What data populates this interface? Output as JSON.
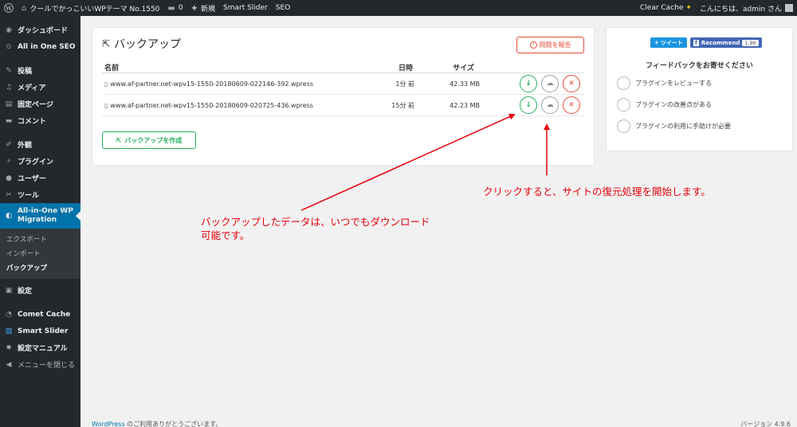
{
  "adminbar": {
    "site_name": "クールでかっこいいWPテーマ No.1550",
    "comments_count": "0",
    "new_label": "新規",
    "smart_slider": "Smart Slider",
    "seo": "SEO",
    "clear_cache": "Clear Cache",
    "greeting": "こんにちは、admin さん"
  },
  "sidebar": {
    "items": [
      {
        "label": "ダッシュボード",
        "icon": "dashboard-icon",
        "glyph": "◉"
      },
      {
        "label": "All in One SEO",
        "icon": "seo-icon",
        "glyph": "⊙"
      },
      {
        "label": "投稿",
        "icon": "pin-icon",
        "glyph": "✎"
      },
      {
        "label": "メディア",
        "icon": "media-icon",
        "glyph": "♫"
      },
      {
        "label": "固定ページ",
        "icon": "page-icon",
        "glyph": "▤"
      },
      {
        "label": "コメント",
        "icon": "comment-icon",
        "glyph": "▬"
      },
      {
        "label": "外観",
        "icon": "appearance-icon",
        "glyph": "✐"
      },
      {
        "label": "プラグイン",
        "icon": "plugin-icon",
        "glyph": "⚡"
      },
      {
        "label": "ユーザー",
        "icon": "user-icon",
        "glyph": "●"
      },
      {
        "label": "ツール",
        "icon": "tool-icon",
        "glyph": "✂"
      }
    ],
    "current": {
      "label": "All-in-One WP Migration",
      "icon": "migration-icon",
      "glyph": "◐"
    },
    "submenu": [
      "エクスポート",
      "インポート",
      "バックアップ"
    ],
    "items_after": [
      {
        "label": "設定",
        "icon": "settings-icon",
        "glyph": "▣"
      },
      {
        "label": "Comet Cache",
        "icon": "comet-icon",
        "glyph": "◔"
      },
      {
        "label": "Smart Slider",
        "icon": "slider-icon",
        "glyph": "▧"
      },
      {
        "label": "設定マニュアル",
        "icon": "manual-gear-icon",
        "glyph": "✹"
      },
      {
        "label": "メニューを閉じる",
        "icon": "collapse-icon",
        "glyph": "◀"
      }
    ]
  },
  "card": {
    "title": "バックアップ",
    "report_label": "問題を報告",
    "columns": {
      "name": "名前",
      "date": "日時",
      "size": "サイズ"
    },
    "rows": [
      {
        "name": "www.af-partner.net-wpv15-1550-20180609-022146-392.wpress",
        "date": "1分 前",
        "size": "42.33 MB"
      },
      {
        "name": "www.af-partner.net-wpv15-1550-20180609-020725-436.wpress",
        "date": "15分 前",
        "size": "42.23 MB"
      }
    ],
    "create_label": "バックアップを作成"
  },
  "feedback": {
    "tweet": "ツイート",
    "recommend": "Recommend",
    "recommend_count": "1.9K",
    "title": "フィードバックをお寄せください",
    "options": [
      "プラグインをレビューする",
      "プラグインの改善点がある",
      "プラグインの利用に手助けが必要"
    ]
  },
  "annotations": {
    "restore": "クリックすると、サイトの復元処理を開始します。",
    "download_line1": "バックアップしたデータは、いつでもダウンロード",
    "download_line2": "可能です。"
  },
  "footer": {
    "link": "WordPress",
    "thanks": " のご利用ありがとうございます。",
    "version": "バージョン 4.9.6"
  },
  "colors": {
    "accent": "#0073aa",
    "download": "#27ae60",
    "delete": "#e74c3c",
    "annotation": "#e8000b"
  }
}
